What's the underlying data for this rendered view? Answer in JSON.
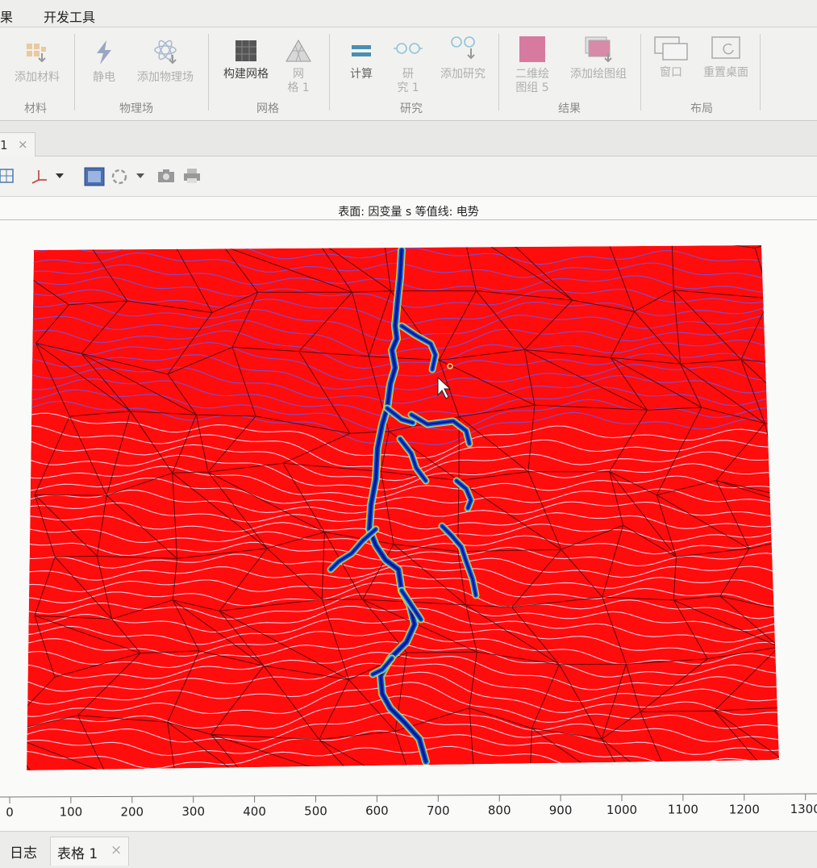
{
  "menu": {
    "item_results": "果",
    "item_dev": "开发工具"
  },
  "ribbon": {
    "groups": {
      "materials": "材料",
      "physics": "物理场",
      "mesh": "网格",
      "study": "研究",
      "results": "结果",
      "layout": "布局"
    },
    "buttons": {
      "add_material": "添加材料",
      "electrostatics": "静电",
      "add_physics": "添加物理场",
      "build_mesh": "构建网格",
      "mesh1_line1": "网",
      "mesh1_line2": "格 1",
      "compute": "计算",
      "study1_line1": "研",
      "study1_line2": "究 1",
      "add_study": "添加研究",
      "plotgroup_line1": "二维绘",
      "plotgroup_line2": "图组 5",
      "add_plot_group": "添加绘图组",
      "window": "窗口",
      "reset_desktop": "重置桌面"
    }
  },
  "graphics_tab": {
    "label": "1",
    "close": "×"
  },
  "plot": {
    "title": "表面: 因变量 s  等值线: 电势",
    "colors": {
      "background": "#ff0d0d",
      "crack": "#1f3fd6",
      "crack_core": "#0a1a8a",
      "contour_light": "#f2d4e8",
      "contour_dark": "#7a4fd8",
      "grain": "#3a0808"
    },
    "x_ticks": [
      "0",
      "100",
      "200",
      "300",
      "400",
      "500",
      "600",
      "700",
      "800",
      "900",
      "1000",
      "1100",
      "1200",
      "1300"
    ]
  },
  "bottom_tabs": {
    "log": "日志",
    "table": "表格 1",
    "close": "×"
  }
}
